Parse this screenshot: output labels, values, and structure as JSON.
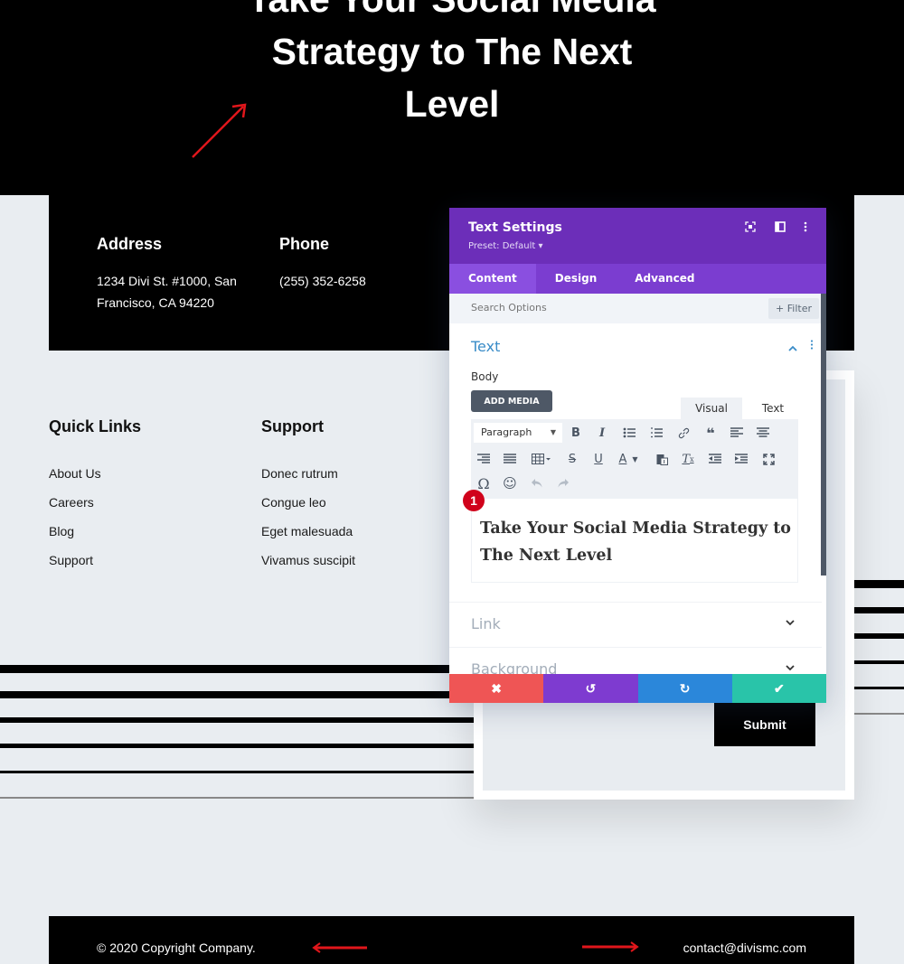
{
  "hero": {
    "title_lines": [
      "Take Your Social Media",
      "Strategy to The Next",
      "Level"
    ]
  },
  "contact": {
    "address_heading": "Address",
    "address_line1": "1234 Divi St. #1000, San",
    "address_line2": "Francisco, CA 94220",
    "phone_heading": "Phone",
    "phone_value": "(255) 352-6258"
  },
  "quick_links": {
    "heading": "Quick Links",
    "items": [
      "About Us",
      "Careers",
      "Blog",
      "Support"
    ]
  },
  "support_links": {
    "heading": "Support",
    "items": [
      "Donec rutrum",
      "Congue leo",
      "Eget malesuada",
      "Vivamus suscipit"
    ]
  },
  "form": {
    "submit_label": "Submit"
  },
  "footer": {
    "copyright": "© 2020 Copyright Company.",
    "email": "contact@divismc.com"
  },
  "panel": {
    "title": "Text Settings",
    "preset": "Preset: Default ▾",
    "header_icons": [
      "expand-icon",
      "split-view-icon",
      "more-vertical-icon"
    ],
    "tabs": [
      "Content",
      "Design",
      "Advanced"
    ],
    "active_tab": "Content",
    "search_placeholder": "Search Options",
    "filter_label": "+ Filter",
    "text_section": {
      "title": "Text",
      "body_label": "Body",
      "add_media_label": "ADD MEDIA",
      "mode_tabs": [
        "Visual",
        "Text"
      ],
      "active_mode": "Visual",
      "format_select": "Paragraph",
      "toolbar_buttons": [
        "bold",
        "italic",
        "bullet-list",
        "numbered-list",
        "link",
        "blockquote",
        "align-left",
        "align-center",
        "align-right",
        "justify",
        "table",
        "strikethrough",
        "underline",
        "text-color",
        "paste-as-text",
        "clear-formatting",
        "outdent",
        "indent",
        "fullscreen",
        "special-character",
        "emoji",
        "undo",
        "redo"
      ],
      "editor_content": "Take Your Social Media Strategy to The Next Level"
    },
    "collapsed_sections": [
      "Link",
      "Background"
    ],
    "badge_number": "1",
    "actions": {
      "cancel": "✖",
      "undo": "↺",
      "redo": "↻",
      "save": "✔"
    },
    "colors": {
      "header": "#6c2eb9",
      "tabs": "#7b3dd0",
      "cancel": "#ef5555",
      "undo": "#7e3bd0",
      "redo": "#2b87da",
      "save": "#29c4a9",
      "section_title": "#3a8cc8"
    }
  }
}
